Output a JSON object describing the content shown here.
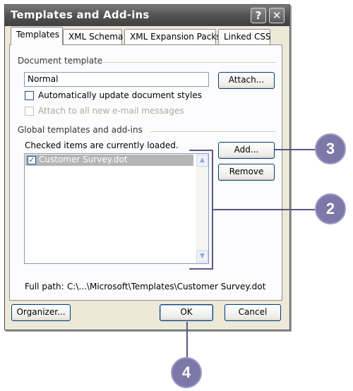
{
  "dialog": {
    "title": "Templates and Add-ins",
    "help_button": "?",
    "close_button": "✕"
  },
  "tabs": [
    {
      "label": "Templates",
      "active": true
    },
    {
      "label": "XML Schema",
      "active": false
    },
    {
      "label": "XML Expansion Packs",
      "active": false
    },
    {
      "label": "Linked CSS",
      "active": false
    }
  ],
  "document_template": {
    "group_label": "Document template",
    "value": "Normal",
    "attach_button": "Attach...",
    "auto_update": {
      "label": "Automatically update document styles",
      "checked": false
    },
    "attach_email": {
      "label": "Attach to all new e-mail messages",
      "checked": false,
      "disabled": true
    }
  },
  "global_templates": {
    "group_label": "Global templates and add-ins",
    "note": "Checked items are currently loaded.",
    "items": [
      {
        "label": "Customer Survey.dot",
        "checked": true,
        "selected": true
      }
    ],
    "add_button": "Add...",
    "remove_button": "Remove"
  },
  "full_path": {
    "label": "Full path:",
    "value": "C:\\...\\Microsoft\\Templates\\Customer Survey.dot"
  },
  "footer": {
    "organizer_button": "Organizer...",
    "ok_button": "OK",
    "cancel_button": "Cancel"
  },
  "callouts": [
    "3",
    "2",
    "4"
  ]
}
